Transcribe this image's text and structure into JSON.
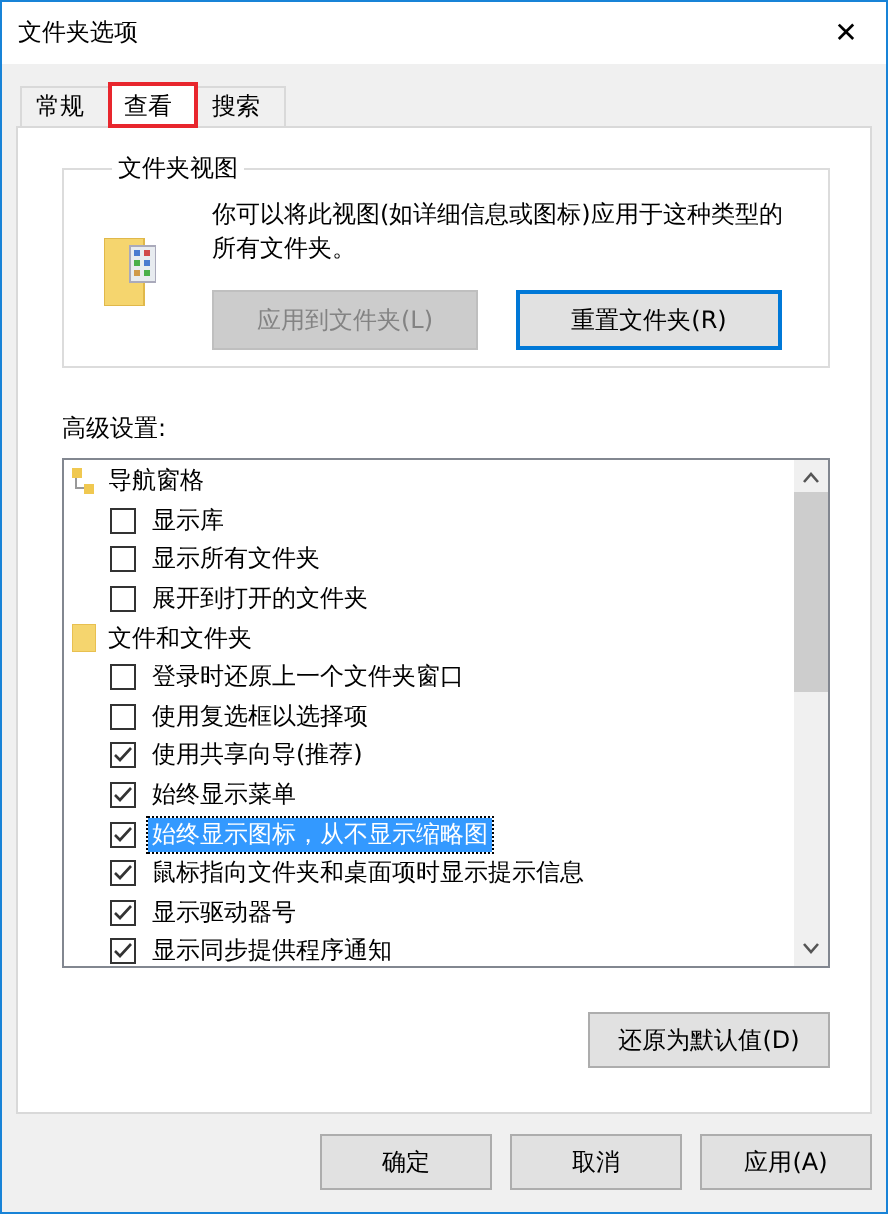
{
  "window": {
    "title": "文件夹选项",
    "close": "✕"
  },
  "tabs": [
    {
      "label": "常规",
      "selected": false,
      "highlighted": false
    },
    {
      "label": "查看",
      "selected": true,
      "highlighted": true
    },
    {
      "label": "搜索",
      "selected": false,
      "highlighted": false
    }
  ],
  "folder_views": {
    "title": "文件夹视图",
    "description": "你可以将此视图(如详细信息或图标)应用于这种类型的所有文件夹。",
    "buttons": [
      {
        "label": "应用到文件夹(L)",
        "disabled": true,
        "focused": false
      },
      {
        "label": "重置文件夹(R)",
        "disabled": false,
        "focused": true
      }
    ]
  },
  "advanced": {
    "label": "高级设置:",
    "items": [
      {
        "kind": "pane",
        "label": "导航窗格",
        "children": [
          {
            "label": "显示库",
            "checked": false,
            "selected": false
          },
          {
            "label": "显示所有文件夹",
            "checked": false,
            "selected": false
          },
          {
            "label": "展开到打开的文件夹",
            "checked": false,
            "selected": false
          }
        ]
      },
      {
        "kind": "folder",
        "label": "文件和文件夹",
        "children": [
          {
            "label": "登录时还原上一个文件夹窗口",
            "checked": false,
            "selected": false
          },
          {
            "label": "使用复选框以选择项",
            "checked": false,
            "selected": false
          },
          {
            "label": "使用共享向导(推荐)",
            "checked": true,
            "selected": false
          },
          {
            "label": "始终显示菜单",
            "checked": true,
            "selected": false
          },
          {
            "label": "始终显示图标，从不显示缩略图",
            "checked": true,
            "selected": true
          },
          {
            "label": "鼠标指向文件夹和桌面项时显示提示信息",
            "checked": true,
            "selected": false
          },
          {
            "label": "显示驱动器号",
            "checked": true,
            "selected": false
          },
          {
            "label": "显示同步提供程序通知",
            "checked": true,
            "selected": false
          }
        ]
      }
    ],
    "restore_button": "还原为默认值(D)"
  },
  "buttons": [
    {
      "label": "确定"
    },
    {
      "label": "取消"
    },
    {
      "label": "应用(A)"
    }
  ]
}
